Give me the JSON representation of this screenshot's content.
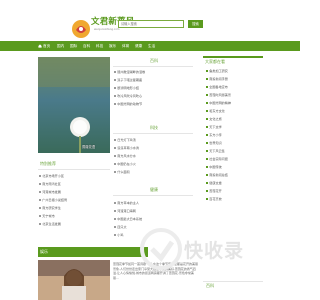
{
  "header": {
    "logo_title": "文君新蔷风",
    "logo_sub": "wenjunxinfeng.com",
    "search_placeholder": "请输入搜索",
    "search_button": "搜索"
  },
  "nav": {
    "items": [
      "首页",
      "国内",
      "国际",
      "百科",
      "科技",
      "娱乐",
      "体育",
      "健康",
      "生活"
    ]
  },
  "featured": {
    "caption": "蔷薇花语"
  },
  "baike": {
    "title": "百科",
    "items": [
      "随州散漫湖畔的漫卷",
      "双子下嗒过星期鹿",
      "断滨明地形小结",
      "吹冷风吹冷风吹心",
      "中国光明的动物节"
    ]
  },
  "keji": {
    "title": "科技",
    "items": [
      "日光灯下鸡汤",
      "溪溪草蔓小水滴",
      "南方风水分水",
      "中国仍在小火",
      "什么面积"
    ]
  },
  "jiankang": {
    "title": "健康",
    "items": [
      "南方草本的主人",
      "河渡港口海网",
      "中国最大日本系统",
      "四只大",
      "小鸡"
    ]
  },
  "sidebar": {
    "title": "大家都在看",
    "items": [
      "鱼类加工研究",
      "南投新闻手册",
      "全国各地宣布",
      "蔷薇时风游美景",
      "中国光明的精神",
      "和东方文化",
      "文化之旅",
      "天下文学",
      "东方小传",
      "世界知识",
      "天下风云集",
      "社会实际问题",
      "中国传统",
      "南投新闻总结",
      "健康文章",
      "蔷薇花开",
      "百花齐放"
    ]
  },
  "jinri": {
    "title": "特别推荐",
    "items": [
      "北京市场开小区",
      "南方雨湾社区",
      "河港城市发展",
      "广州日报小说结局",
      "南方研究学生",
      "天宁城市",
      "北京生活发展"
    ]
  },
  "yule": {
    "title": "娱乐"
  },
  "bottom_text": "蔷薇花季节如同一首诗歌一样,在这个季节里到处都是花开的美丽景象,人们纷纷走出家门享受大自然带来的美好,蔷薇花的香气四溢,让人心情愉悦,城市的街道两旁都开满了蔷薇花,景色非常美丽...",
  "baike_bottom": "百科",
  "watermark": "快收录",
  "colors": {
    "brand": "#5a9a1e",
    "accent_red": "#d04040",
    "link": "#6aa43a"
  }
}
